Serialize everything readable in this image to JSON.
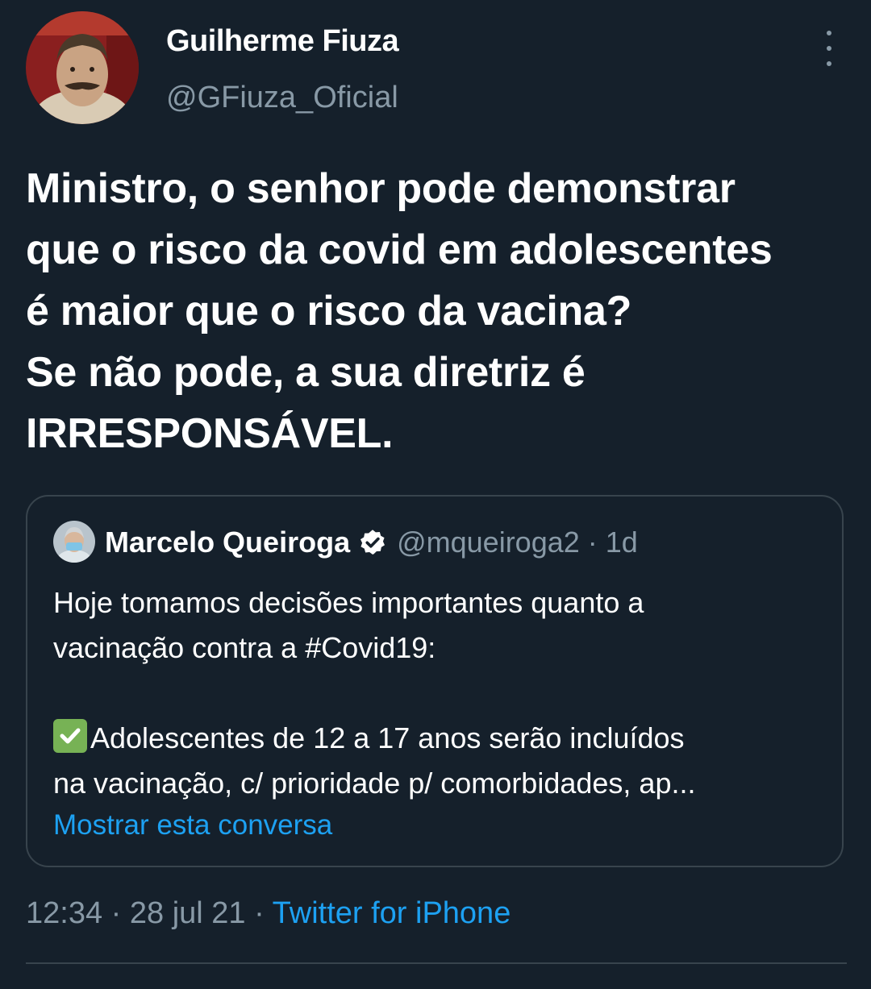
{
  "author": {
    "display_name": "Guilherme Fiuza",
    "handle": "@GFiuza_Oficial"
  },
  "tweet": {
    "lines": [
      "Ministro, o senhor pode demonstrar",
      "que o risco da covid em adolescentes",
      "é maior que o risco da vacina?",
      "Se não pode, a sua diretriz é",
      "IRRESPONSÁVEL."
    ]
  },
  "quoted_tweet": {
    "display_name": "Marcelo Queiroga",
    "verified": true,
    "handle": "@mqueiroga2",
    "separator": "·",
    "time_ago": "1d",
    "body_lines": [
      "Hoje tomamos decisões importantes quanto a",
      "vacinação contra a #Covid19:",
      "",
      "Adolescentes de 12 a 17 anos serão incluídos",
      "na vacinação, c/ prioridade p/ comorbidades, ap..."
    ],
    "check_emoji": "check-mark-button-icon",
    "show_thread_link": "Mostrar esta conversa"
  },
  "meta": {
    "time": "12:34",
    "separator": " · ",
    "date": "28 jul 21",
    "source": "Twitter for iPhone"
  },
  "colors": {
    "background": "#15202b",
    "text_primary": "#ffffff",
    "text_secondary": "#8899a6",
    "accent": "#1da1f2",
    "border": "#38444d"
  },
  "icons": {
    "more": "more-vertical-icon",
    "verified": "verified-badge-icon"
  }
}
